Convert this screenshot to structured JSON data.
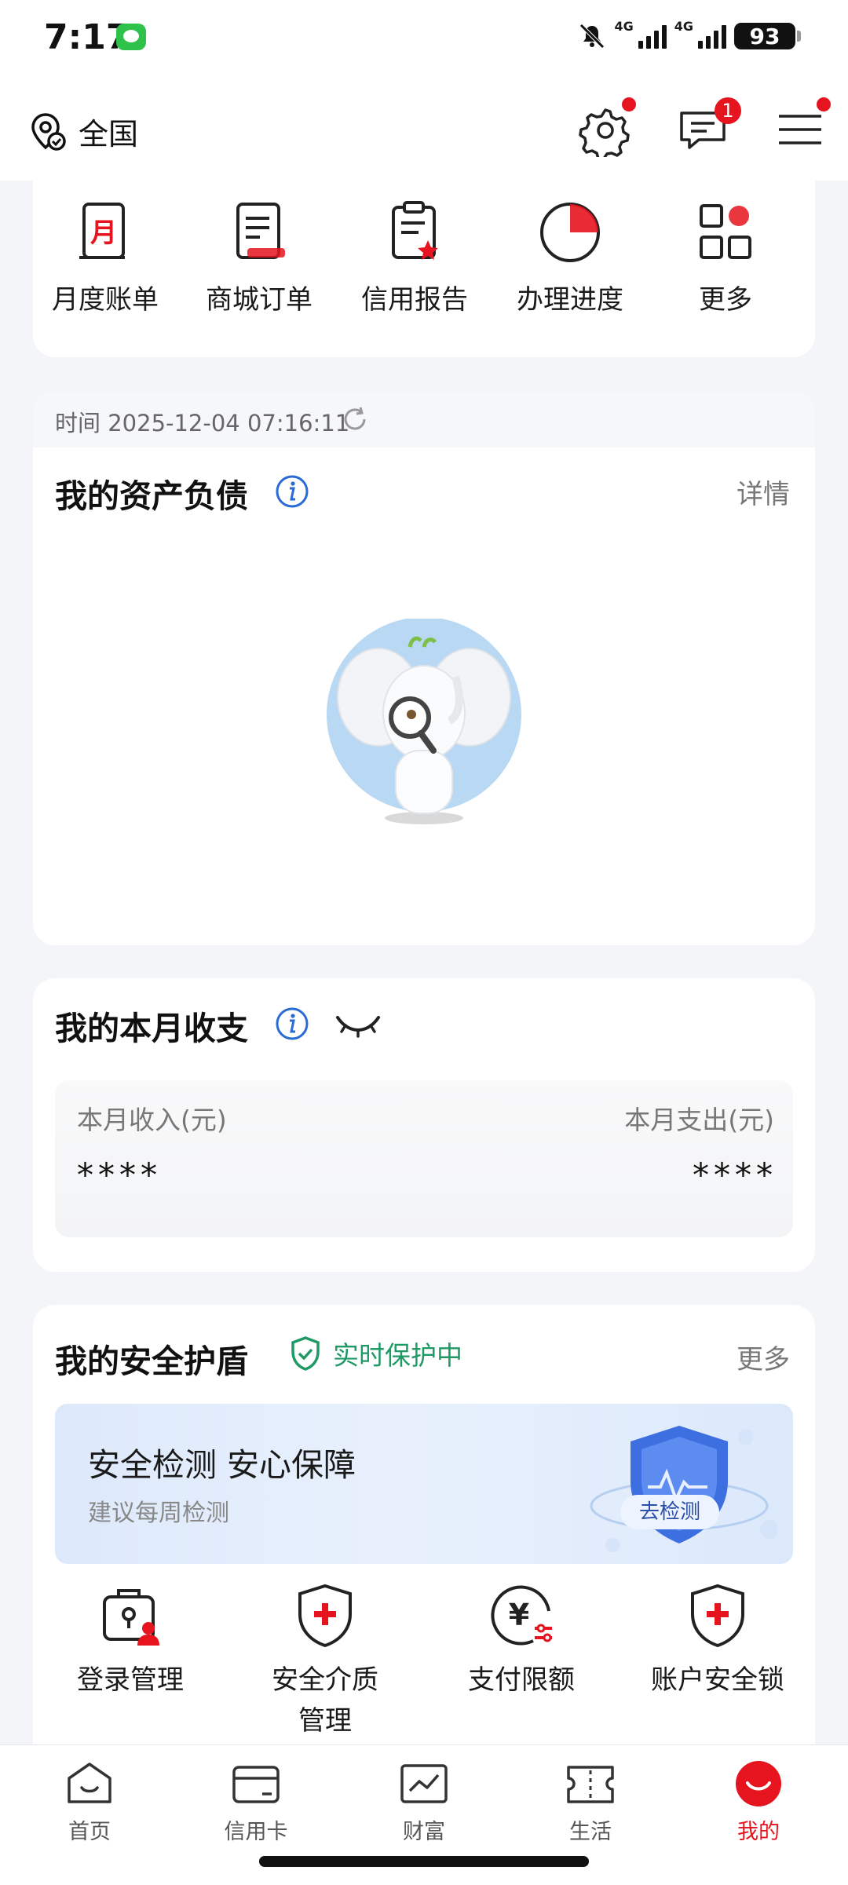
{
  "status_bar": {
    "time": "7:17",
    "network_1": "4G",
    "network_2": "4G",
    "battery": "93"
  },
  "header": {
    "location": "全国",
    "messages_badge": "1"
  },
  "quick_actions": [
    {
      "label": "月度账单",
      "icon": "monthly-bill-icon",
      "glyph": "月"
    },
    {
      "label": "商城订单",
      "icon": "mall-order-icon"
    },
    {
      "label": "信用报告",
      "icon": "credit-report-icon"
    },
    {
      "label": "办理进度",
      "icon": "progress-icon"
    },
    {
      "label": "更多",
      "icon": "more-grid-icon"
    }
  ],
  "assets": {
    "time_label": "时间 2025-12-04 07:16:11",
    "title": "我的资产负债",
    "detail_link": "详情"
  },
  "income": {
    "title": "我的本月收支",
    "income_label": "本月收入(元)",
    "expense_label": "本月支出(元)",
    "income_value": "****",
    "expense_value": "****"
  },
  "security": {
    "title": "我的安全护盾",
    "status": "实时保护中",
    "more_link": "更多",
    "banner_title": "安全检测 安心保障",
    "banner_subtitle": "建议每周检测",
    "banner_button": "去检测",
    "items": [
      {
        "label": "登录管理"
      },
      {
        "label": "安全介质\n管理"
      },
      {
        "label": "支付限额",
        "glyph": "¥"
      },
      {
        "label": "账户安全锁"
      }
    ]
  },
  "tabs": [
    {
      "label": "首页"
    },
    {
      "label": "信用卡"
    },
    {
      "label": "财富"
    },
    {
      "label": "生活"
    },
    {
      "label": "我的"
    }
  ],
  "colors": {
    "accent_red": "#e5141e",
    "safe_green": "#1f9a64",
    "info_blue": "#2a6ad4"
  }
}
